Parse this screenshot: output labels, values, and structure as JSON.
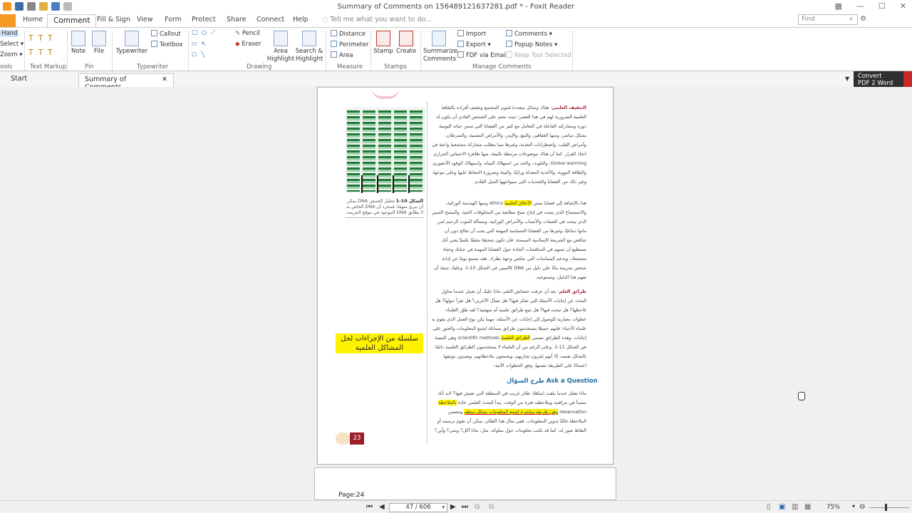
{
  "window": {
    "title": "Summary of Comments on 156489121637281.pdf * - Foxit Reader"
  },
  "menu": {
    "tabs": [
      "Home",
      "Comment",
      "Fill & Sign",
      "View",
      "Form",
      "Protect",
      "Share",
      "Connect",
      "Help"
    ],
    "active": "Comment",
    "tellme": "Tell me what you want to do...",
    "find_placeholder": "Find"
  },
  "ribbon": {
    "tools": {
      "hand": "Hand",
      "select": "Select",
      "zoom": "Zoom",
      "label": "ools"
    },
    "text_markup": {
      "label": "Text Markup"
    },
    "pin": {
      "note": "Note",
      "file": "File",
      "label": "Pin"
    },
    "typewriter": {
      "typewriter": "Typewriter",
      "callout": "Callout",
      "textbox": "Textbox",
      "label": "Typewriter"
    },
    "drawing": {
      "pencil": "Pencil",
      "eraser": "Eraser",
      "area_highlight": "Area Highlight",
      "search_highlight": "Search & Highlight",
      "label": "Drawing"
    },
    "measure": {
      "distance": "Distance",
      "perimeter": "Perimeter",
      "area": "Area",
      "label": "Measure"
    },
    "stamps": {
      "stamp": "Stamp",
      "create": "Create",
      "label": "Stamps"
    },
    "manage": {
      "summarize": "Summarize Comments",
      "import": "Import",
      "export": "Export",
      "fdf_email": "FDF via Email",
      "comments": "Comments",
      "popup_notes": "Popup Notes",
      "keep_tool": "Keep Tool Selected",
      "label": "Manage Comments"
    }
  },
  "doc_tabs": {
    "start": "Start",
    "active": "Summary of Comments..."
  },
  "convert": {
    "line1": "Convert",
    "line2": "PDF 2 Word"
  },
  "page": {
    "caption_bold": "الشكل 10-1",
    "caption_text": "تحليل الحمض DNA يمكن أن يبرئ متهمًا، فمجرد أن DNA الخاص به لا يطابق DNA الموجود في موقع الجريمة.",
    "para1_head": "التثقيف العلمي",
    "para1": "هناك وسائل متعددة لتنوير المجتمع وتثقيف أفراده بالثقافة العلمية الضرورية لهم في هذا العصر؛ حيث تحتم على الشخص العادي أن يكون له دوره ومشاركته الفاعلة في التعامل مع كثير من القضايا التي تمس حياته اليومية بشكل مباشر، ومنها العقاقير، والتبغ، والإيدز، والأمراض النفسية، والسرطان، وأمراض القلب، واضطرابات التغذية، وغيرها مما يتطلب مشاركة مجتمعية واعية في اتخاذ القرار. كما أن هناك موضوعات مرتبطة بالبيئة، منها ظاهرة الاحتباس الحراري Global warming، والتلوث، والحد من استهلاك المياه، واستهلاك الوقود الأحفوري، والطاقة النووية، والأغذية المعدلة وراثيًا، والبيئة وضرورة الحفاظ عليها وعلى تنوعها، وغير ذلك من القضايا والتحديات التي سيواجهها الجيل القادم.",
    "para2_pre": "هذا بالإضافة إلى قضايا تمس",
    "para2_hl": "الأخلاق العلمية",
    "para2": "ethics ومنها الهندسة الوراثية، والاستنساخ الذي يبحث في إنتاج نسخ مطابقة من المخلوقات الحية، والمسح الجيني الذي يبحث في الصفات والأنساب والأمراض الوراثية، ومسألة الموت الرحيم لمن ماتوا دماغيًا، وغيرها من القضايا الحساسة المهمة التي يجب أن تعالج دون أن تتناقض مع الشريعة الإسلامية السمحة. فأن تكون شخصًا مثقفًا علميًا يعني أنك تستطيع أن تسهم في المناقشات الجادة حول القضايا المهمة في حياتك وحياة مجتمعك، وتدعم السياسات التي تعكس وجهة نظرك. فقد تسمع يومًا عن إدانة شخص بجريمة بناءً على دليل من DNA كالمبين في الشكل 10-1. وعليك حينئذ أن تفهم هذا الدليل، وتستوعبه.",
    "para3_head": "طرائق العلم",
    "para3": "بعد أن عرفت خصائص العلم، ماذا عليك أن تعمل عندما تحاول البحث عن إجابات الأسئلة التي تفكر فيها؟ هل تسأل الآخرين؟ هل تقرأ حولها؟ هل تلاحظها؟ هل تبحث فيها؟ هل تتبع طرائق علمية أم منهجية؟ لقد طوّر العلماء خطوات معيارية للوصول إلى إجابات عن الأسئلة، مهما يكن نوع العمل الذي يقوم به علماء الأحياء؛ فإنهم جميعًا يستخدمون طرائق متماثلة لجمع المعلومات والعثور على إجابات. وهذه الطرائق تسمى",
    "para3_hl": "الطرائق العلمية",
    "para3_post": "scientific methods وهي المبينة في الشكل 11-1. وعلى الرغم من أن العلماء لا يستخدمون الطرائق العلمية دائمًا بالشكل نفسه، إلا أنهم يُجرون تجاربهم، ويجمعون ملاحظاتهم، ويعيدون توثيقها اعتمادًا على الطريقة نفسها، وفق الخطوات الآتية:",
    "callout": "سلسلة من الإجراءات لحل المشاكل العلمية",
    "section_head": "طرح السؤال Ask a Question",
    "para4_pre": "ماذا تفعل عندما يلفت انتباهك طائر غريب في المنطقة التي تعيش فيها؟ لابد أنك ستبدأ في مراقبته وملاحظته فترة من الوقت. يبدأ البحث العلمي عادة",
    "para4_hl1": "بالملاحظة",
    "para4_mid": "observation",
    "para4_hl2": "وهي طريقة مباشرة لجمع المعلومات بشكل منظم",
    "para4_post": "وتتضمن الملاحظة غالبًا تدوين المعلومات. ففي مثال هذا الطائر، يمكن أن تقوم برسمه أو التقاط صور له، كما قد تكتب معلومات حول سلوكه، مثل: ماذا أكل؟ ومتى؟ وأين؟",
    "page_number": "23",
    "next_page_label": "Page:24"
  },
  "status": {
    "page_indicator": "47 / 606",
    "zoom": "75%"
  }
}
